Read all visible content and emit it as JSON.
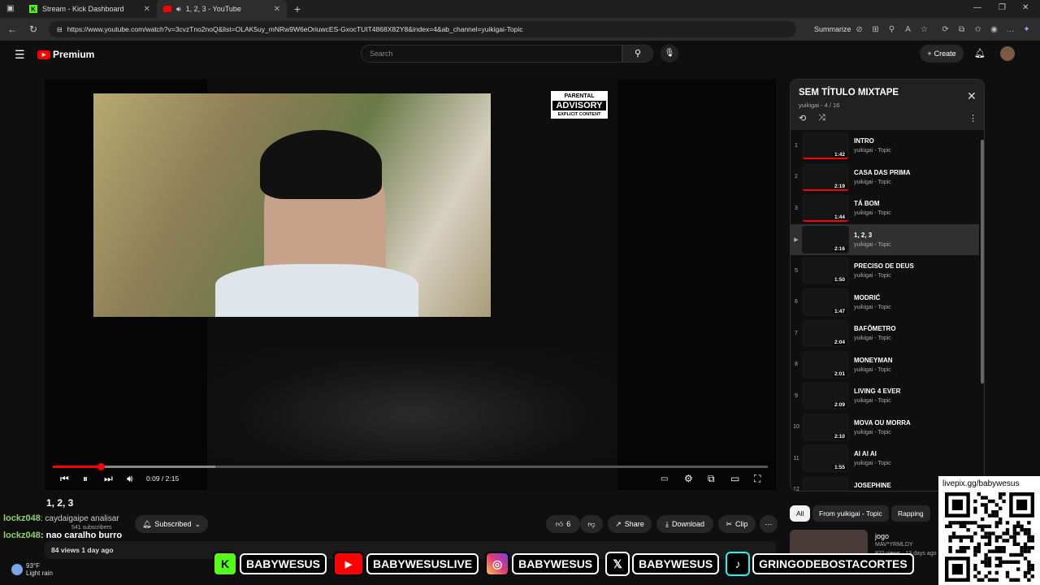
{
  "browser": {
    "tabs": [
      {
        "label": "Stream - Kick Dashboard"
      },
      {
        "label": "1, 2, 3 - YouTube"
      }
    ],
    "url": "https://www.youtube.com/watch?v=3cvzTno2noQ&list=OLAK5uy_mNRw9W6eOriuwcES-GxocTUIT4868X82Y8&index=4&ab_channel=yuikigai-Topic",
    "summarize_label": "Summarize"
  },
  "youtube": {
    "logo_text": "Premium",
    "search_placeholder": "Search",
    "create_label": "Create"
  },
  "player": {
    "advisory_top": "PARENTAL",
    "advisory_big": "ADVISORY",
    "advisory_bottom": "EXPLICIT CONTENT",
    "time": "0:09 / 2:15",
    "progress_fraction": 0.067
  },
  "video": {
    "title": "1, 2, 3",
    "channel_overlap": "yuikigai - Topic",
    "subscribers": "541 subscribers",
    "subscribe_label": "Subscribed",
    "likes": "6",
    "share_label": "Share",
    "download_label": "Download",
    "clip_label": "Clip",
    "views_date": "84 views  1 day ago"
  },
  "chat": {
    "line1_user": "lockz048",
    "line1_rest": ": caydaigaipe analisar",
    "line2_user": "lockz048",
    "line2_msg": ": nao caralho burro"
  },
  "playlist": {
    "title": "SEM TÍTULO MIXTAPE",
    "subtitle": "yuikigai - 4 / 16",
    "items": [
      {
        "index": "1",
        "name": "INTRO",
        "channel": "yuikigai - Topic",
        "duration": "1:42",
        "watched": 1
      },
      {
        "index": "2",
        "name": "CASA DAS PRIMA",
        "channel": "yuikigai - Topic",
        "duration": "2:19",
        "watched": 1
      },
      {
        "index": "3",
        "name": "TÁ BOM",
        "channel": "yuikigai - Topic",
        "duration": "1:44",
        "watched": 1
      },
      {
        "index": "▶",
        "name": "1, 2, 3",
        "channel": "yuikigai - Topic",
        "duration": "2:16",
        "watched": 0
      },
      {
        "index": "5",
        "name": "PRECISO DE DEUS",
        "channel": "yuikigai - Topic",
        "duration": "1:50",
        "watched": 0
      },
      {
        "index": "6",
        "name": "MODRIĆ",
        "channel": "yuikigai - Topic",
        "duration": "1:47",
        "watched": 0
      },
      {
        "index": "7",
        "name": "BAFÔMETRO",
        "channel": "yuikigai - Topic",
        "duration": "2:04",
        "watched": 0
      },
      {
        "index": "8",
        "name": "MONEYMAN",
        "channel": "yuikigai - Topic",
        "duration": "2:01",
        "watched": 0
      },
      {
        "index": "9",
        "name": "LIVING 4 EVER",
        "channel": "yuikigai - Topic",
        "duration": "2:09",
        "watched": 0
      },
      {
        "index": "10",
        "name": "MOVA OU MORRA",
        "channel": "yuikigai - Topic",
        "duration": "2:10",
        "watched": 0
      },
      {
        "index": "11",
        "name": "AI AI AI",
        "channel": "yuikigai - Topic",
        "duration": "1:55",
        "watched": 0
      },
      {
        "index": "12",
        "name": "JOSEPHINE",
        "channel": "yuikigai - Topic",
        "duration": "",
        "watched": 0
      }
    ]
  },
  "chips": {
    "all": "All",
    "from": "From yuikigai - Topic",
    "rapping": "Rapping"
  },
  "related": {
    "title": "jogo",
    "channel": "MAV*YRMLDY",
    "views": "822 views · 13 days ago"
  },
  "overlay": {
    "qr_label": "livepix.gg/babywesus",
    "kick": "BABYWESUS",
    "youtube": "BABYWESUSLIVE",
    "instagram": "BABYWESUS",
    "x": "BABYWESUS",
    "tiktok": "GRINGODEBOSTACORTES"
  },
  "taskbar": {
    "temp": "93°F",
    "weather": "Light rain"
  }
}
